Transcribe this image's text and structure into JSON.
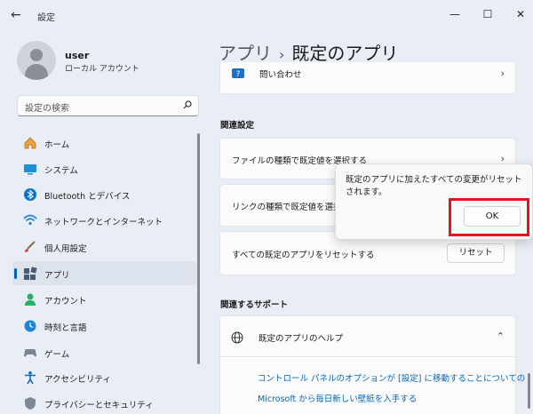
{
  "window": {
    "title": "設定",
    "back_glyph": "←",
    "minimize_glyph": "—",
    "maximize_glyph": "☐",
    "close_glyph": "✕"
  },
  "profile": {
    "name": "user",
    "account_type": "ローカル アカウント"
  },
  "search": {
    "placeholder": "設定の検索"
  },
  "sidebar": {
    "items": [
      {
        "label": "ホーム",
        "icon": "home-icon",
        "active": false
      },
      {
        "label": "システム",
        "icon": "system-icon",
        "active": false
      },
      {
        "label": "Bluetooth とデバイス",
        "icon": "bluetooth-icon",
        "active": false
      },
      {
        "label": "ネットワークとインターネット",
        "icon": "network-icon",
        "active": false
      },
      {
        "label": "個人用設定",
        "icon": "personalization-icon",
        "active": false
      },
      {
        "label": "アプリ",
        "icon": "apps-icon",
        "active": true
      },
      {
        "label": "アカウント",
        "icon": "account-icon",
        "active": false
      },
      {
        "label": "時刻と言語",
        "icon": "time-language-icon",
        "active": false
      },
      {
        "label": "ゲーム",
        "icon": "gaming-icon",
        "active": false
      },
      {
        "label": "アクセシビリティ",
        "icon": "accessibility-icon",
        "active": false
      },
      {
        "label": "プライバシーとセキュリティ",
        "icon": "privacy-icon",
        "active": false
      }
    ]
  },
  "breadcrumb": {
    "parent": "アプリ",
    "separator": "›",
    "current": "既定のアプリ"
  },
  "main": {
    "contact_item": "問い合わせ",
    "related_settings_heading": "関連設定",
    "file_type_item": "ファイルの種類で既定値を選択する",
    "link_type_item": "リンクの種類で既定値を選択する",
    "reset_item": "すべての既定のアプリをリセットする",
    "reset_button": "リセット",
    "related_support_heading": "関連するサポート",
    "help_item": "既定のアプリのヘルプ",
    "help_links": [
      "コントロール パネルのオプションが [設定] に移動することについての",
      "Microsoft から毎日新しい壁紙を入手する"
    ],
    "chevron_right": "›",
    "chevron_up": "⌃"
  },
  "flyout": {
    "message": "既定のアプリに加えたすべての変更がリセットされます。",
    "ok_button": "OK"
  },
  "colors": {
    "accent": "#005fb8",
    "link": "#0067c0",
    "highlight": "#e3141b",
    "background": "#e9eef6"
  }
}
